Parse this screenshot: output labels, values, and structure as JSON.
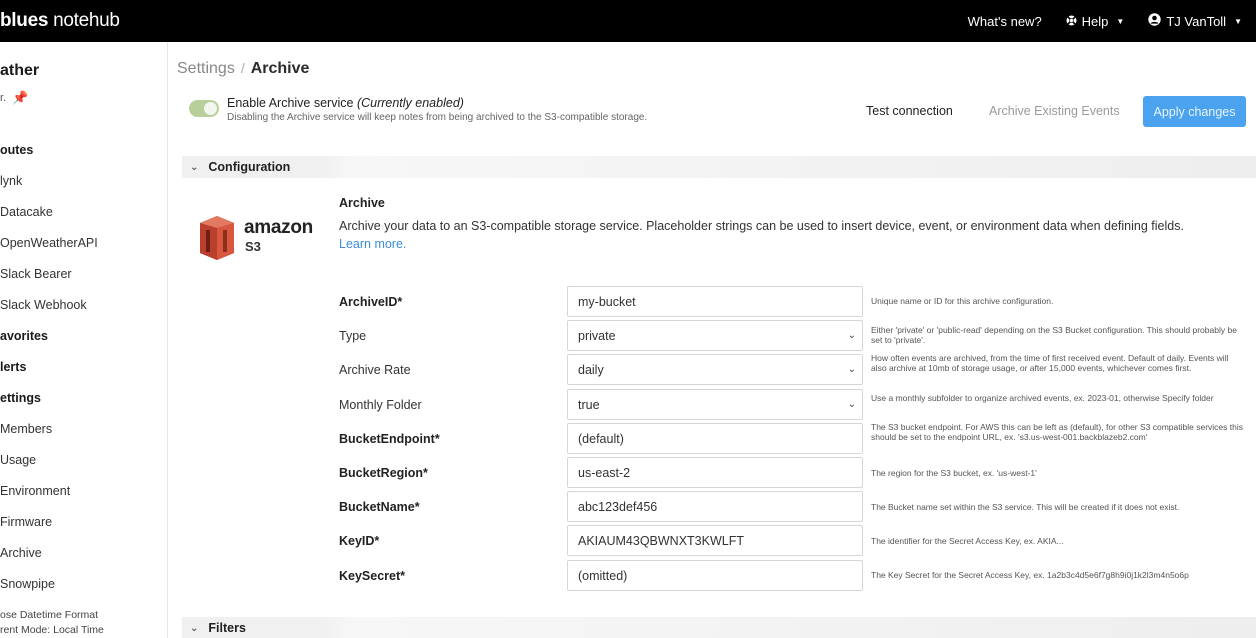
{
  "topbar": {
    "brand_bold": "blues",
    "brand_thin": " notehub",
    "whats_new": "What's new?",
    "help": "Help",
    "user": "TJ VanToll"
  },
  "sidebar": {
    "project_name": "ather",
    "project_sub": "r.",
    "items": [
      {
        "label": "outes",
        "bold": true
      },
      {
        "label": "lynk",
        "bold": false
      },
      {
        "label": "Datacake",
        "bold": false
      },
      {
        "label": "OpenWeatherAPI",
        "bold": false
      },
      {
        "label": "Slack Bearer",
        "bold": false
      },
      {
        "label": "Slack Webhook",
        "bold": false
      },
      {
        "label": "avorites",
        "bold": true
      },
      {
        "label": "lerts",
        "bold": true
      },
      {
        "label": "ettings",
        "bold": true
      },
      {
        "label": "Members",
        "bold": false
      },
      {
        "label": "Usage",
        "bold": false
      },
      {
        "label": "Environment",
        "bold": false
      },
      {
        "label": "Firmware",
        "bold": false
      },
      {
        "label": "Archive",
        "bold": false
      },
      {
        "label": "Snowpipe",
        "bold": false
      }
    ],
    "footer_line1": "ose Datetime Format",
    "footer_line2": "rent Mode: Local Time"
  },
  "breadcrumb": {
    "parent": "Settings",
    "separator": "/",
    "current": "Archive"
  },
  "service": {
    "enabled": true,
    "title": "Enable Archive service",
    "status": "(Currently enabled)",
    "description": "Disabling the Archive service will keep notes from being archived to the S3-compatible storage."
  },
  "actions": {
    "test_connection": "Test connection",
    "archive_existing": "Archive Existing Events",
    "apply_changes": "Apply changes"
  },
  "configuration": {
    "section_label": "Configuration",
    "logo_word": "amazon",
    "logo_sub": "S3",
    "title": "Archive",
    "description": "Archive your data to an S3-compatible storage service. Placeholder strings can be used to insert device, event, or environment data when defining fields.",
    "learn_more": "Learn more."
  },
  "form": [
    {
      "label": "ArchiveID*",
      "required": true,
      "value": "my-bucket",
      "select": false,
      "hint": "Unique name or ID for this archive configuration."
    },
    {
      "label": "Type",
      "required": false,
      "value": "private",
      "select": true,
      "hint": "Either 'private' or 'public-read' depending on the S3 Bucket configuration. This should probably be set to 'private'."
    },
    {
      "label": "Archive Rate",
      "required": false,
      "value": "daily",
      "select": true,
      "hint": "How often events are archived, from the time of first received event. Default of daily. Events will also archive at 10mb of storage usage, or after 15,000 events, whichever comes first."
    },
    {
      "label": "Monthly Folder",
      "required": false,
      "value": "true",
      "select": true,
      "hint": "Use a monthly subfolder to organize archived events, ex. 2023-01, otherwise Specify folder"
    },
    {
      "label": "BucketEndpoint*",
      "required": true,
      "value": "(default)",
      "select": false,
      "hint": "The S3 bucket endpoint. For AWS this can be left as (default), for other S3 compatible services this should be set to the endpoint URL, ex. 's3.us-west-001.backblazeb2.com'"
    },
    {
      "label": "BucketRegion*",
      "required": true,
      "value": "us-east-2",
      "select": false,
      "hint": "The region for the S3 bucket, ex. 'us-west-1'"
    },
    {
      "label": "BucketName*",
      "required": true,
      "value": "abc123def456",
      "select": false,
      "hint": "The Bucket name set within the S3 service. This will be created if it does not exist."
    },
    {
      "label": "KeyID*",
      "required": true,
      "value": "AKIAUM43QBWNXT3KWLFT",
      "select": false,
      "hint": "The identifier for the Secret Access Key, ex. AKIA..."
    },
    {
      "label": "KeySecret*",
      "required": true,
      "value": "(omitted)",
      "select": false,
      "hint": "The Key Secret for the Secret Access Key, ex. 1a2b3c4d5e6f7g8h9i0j1k2l3m4n5o6p"
    }
  ],
  "filters": {
    "section_label": "Filters"
  },
  "colors": {
    "topbar_bg": "#000000",
    "accent": "#4ba3f0",
    "toggle_on": "#b9cf9a",
    "link": "#3d8bd9",
    "s3_red": "#c0392b"
  }
}
